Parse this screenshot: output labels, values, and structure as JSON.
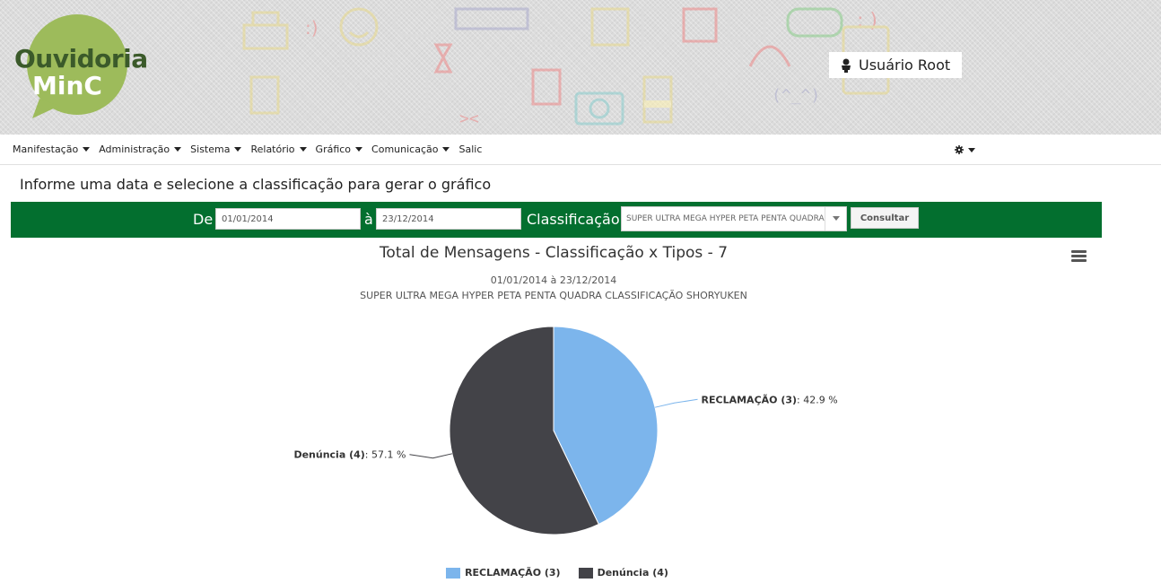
{
  "header": {
    "logo_line1": "Ouvidoria",
    "logo_line2": "MinC",
    "user_name": "Usuário Root",
    "colors": {
      "logo_bubble": "#9dbb5b",
      "logo_text": "#3b5a2a"
    }
  },
  "nav": {
    "items": [
      {
        "label": "Manifestação",
        "has_caret": true
      },
      {
        "label": "Administração",
        "has_caret": true
      },
      {
        "label": "Sistema",
        "has_caret": true
      },
      {
        "label": "Relatório",
        "has_caret": true
      },
      {
        "label": "Gráfico",
        "has_caret": true
      },
      {
        "label": "Comunicação",
        "has_caret": true
      },
      {
        "label": "Salic",
        "has_caret": false
      }
    ],
    "settings_icon": "gear-icon"
  },
  "filter": {
    "instructions": "Informe uma data e selecione a classificação para gerar o gráfico",
    "from_label": "De",
    "from_value": "01/01/2014",
    "to_label": "à",
    "to_value": "23/12/2014",
    "classification_label": "Classificação",
    "classification_value": "SUPER ULTRA MEGA HYPER PETA PENTA QUADRA CLASSIFICAÇÃO SHORYUKEN",
    "submit_label": "Consultar",
    "bar_color": "#036f2f"
  },
  "chart": {
    "title": "Total de Mensagens - Classificação x Tipos - 7",
    "subtitle_dates": "01/01/2014 à 23/12/2014",
    "subtitle_classification": "SUPER ULTRA MEGA HYPER PETA PENTA QUADRA CLASSIFICAÇÃO SHORYUKEN",
    "menu_icon": "hamburger-menu-icon"
  },
  "chart_data": {
    "type": "pie",
    "title": "Total de Mensagens - Classificação x Tipos - 7",
    "subtitle": "01/01/2014 à 23/12/2014 SUPER ULTRA MEGA HYPER PETA PENTA QUADRA CLASSIFICAÇÃO SHORYUKEN",
    "slices": [
      {
        "name": "RECLAMAÇÃO (3)",
        "value": 3,
        "percent": "42.9 %",
        "color": "#7cb5ec"
      },
      {
        "name": "Denúncia (4)",
        "value": 4,
        "percent": "57.1 %",
        "color": "#434348"
      }
    ],
    "legend_position": "bottom"
  }
}
